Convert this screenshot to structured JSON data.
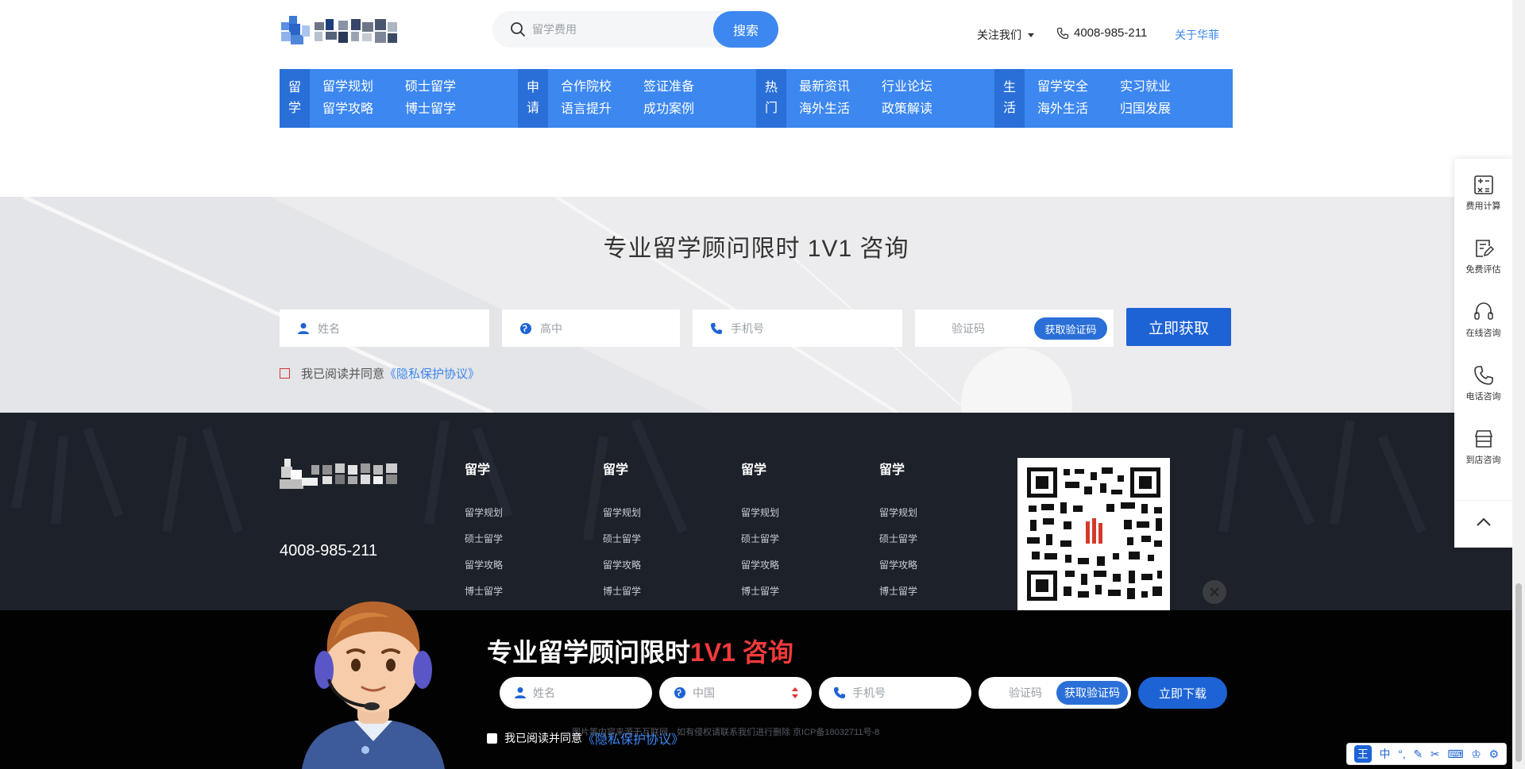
{
  "header": {
    "search_placeholder": "留学费用",
    "search_button": "搜索",
    "follow_us": "关注我们",
    "phone": "4008-985-211",
    "about": "关于华菲"
  },
  "nav": [
    {
      "tag": [
        "留",
        "学"
      ],
      "items": [
        "留学规划",
        "硕士留学",
        "留学攻略",
        "博士留学"
      ]
    },
    {
      "tag": [
        "申",
        "请"
      ],
      "items": [
        "合作院校",
        "签证准备",
        "语言提升",
        "成功案例"
      ]
    },
    {
      "tag": [
        "热",
        "门"
      ],
      "items": [
        "最新资讯",
        "行业论坛",
        "海外生活",
        "政策解读"
      ]
    },
    {
      "tag": [
        "生",
        "活"
      ],
      "items": [
        "留学安全",
        "实习就业",
        "海外生活",
        "归国发展"
      ]
    }
  ],
  "consult": {
    "title": "专业留学顾问限时 1V1 咨询",
    "name_placeholder": "姓名",
    "grade_placeholder": "高中",
    "phone_placeholder": "手机号",
    "code_placeholder": "验证码",
    "get_code": "获取验证码",
    "submit": "立即获取",
    "agree_text": "我已阅读并同意",
    "privacy_link": "《隐私保护协议》"
  },
  "footer": {
    "phone": "4008-985-211",
    "columns": [
      {
        "title": "留学",
        "links": [
          "留学规划",
          "硕士留学",
          "留学攻略",
          "博士留学"
        ]
      },
      {
        "title": "留学",
        "links": [
          "留学规划",
          "硕士留学",
          "留学攻略",
          "博士留学"
        ]
      },
      {
        "title": "留学",
        "links": [
          "留学规划",
          "硕士留学",
          "留学攻略",
          "博士留学"
        ]
      },
      {
        "title": "留学",
        "links": [
          "留学规划",
          "硕士留学",
          "留学攻略",
          "博士留学"
        ]
      }
    ],
    "copyright": "图片等内容来源于互联网，如有侵权请联系我们进行删除 京ICP备18032711号-8"
  },
  "banner": {
    "title_prefix": "专业留学顾问限时",
    "title_highlight": "1V1 咨询",
    "name_placeholder": "姓名",
    "country_value": "中国",
    "phone_placeholder": "手机号",
    "code_placeholder": "验证码",
    "get_code": "获取验证码",
    "download": "立即下载",
    "agree_text": "我已阅读并同意",
    "privacy_link": "《隐私保护协议》"
  },
  "side": {
    "items": [
      "费用计算",
      "免费评估",
      "在线咨询",
      "电话咨询",
      "到店咨询"
    ]
  },
  "ime": {
    "logo": "王",
    "mode": "中"
  },
  "colors": {
    "primary": "#3c87f0",
    "primary_dark": "#1e63d5",
    "footer_bg": "#1d2129",
    "highlight_red": "#f23a3a"
  }
}
